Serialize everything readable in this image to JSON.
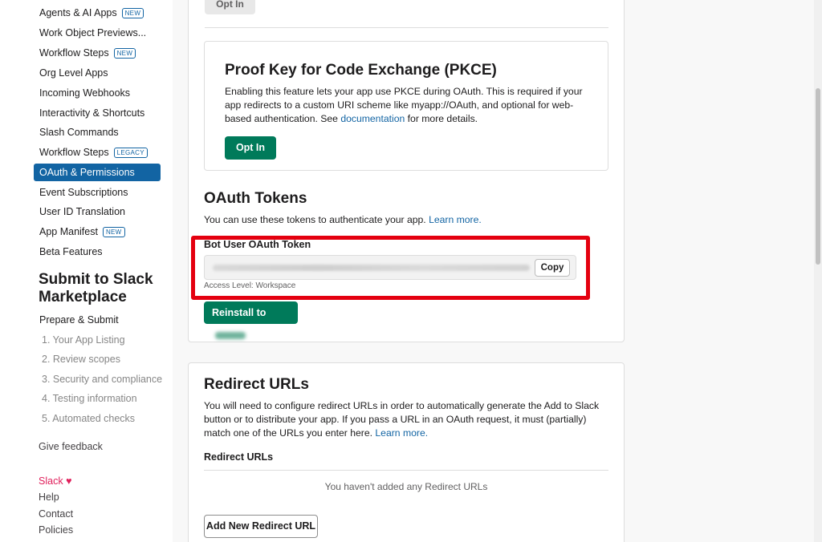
{
  "sidebar": {
    "items": [
      {
        "label": "Agents & AI Apps",
        "badge": "NEW"
      },
      {
        "label": "Work Object Previews...",
        "badge": ""
      },
      {
        "label": "Workflow Steps",
        "badge": "NEW"
      },
      {
        "label": "Org Level Apps",
        "badge": ""
      },
      {
        "label": "Incoming Webhooks",
        "badge": ""
      },
      {
        "label": "Interactivity & Shortcuts",
        "badge": ""
      },
      {
        "label": "Slash Commands",
        "badge": ""
      },
      {
        "label": "Workflow Steps",
        "badge": "LEGACY"
      },
      {
        "label": "OAuth & Permissions",
        "badge": "",
        "active": true
      },
      {
        "label": "Event Subscriptions",
        "badge": ""
      },
      {
        "label": "User ID Translation",
        "badge": ""
      },
      {
        "label": "App Manifest",
        "badge": "NEW"
      },
      {
        "label": "Beta Features",
        "badge": ""
      }
    ],
    "marketplace_heading": "Submit to Slack Marketplace",
    "prepare_submit": "Prepare & Submit",
    "steps": [
      "1. Your App Listing",
      "2. Review scopes",
      "3. Security and compliance",
      "4. Testing information",
      "5. Automated checks"
    ],
    "give_feedback": "Give feedback",
    "footer": {
      "slack": "Slack",
      "heart": "♥",
      "help": "Help",
      "contact": "Contact",
      "policies": "Policies"
    }
  },
  "top_opt_in_label": "Opt In",
  "pkce": {
    "title": "Proof Key for Code Exchange (PKCE)",
    "description_before": "Enabling this feature lets your app use PKCE during OAuth. This is required if your app redirects to a custom URI scheme like myapp://OAuth, and optional for web-based authentication. See ",
    "doc_link": "documentation",
    "description_after": " for more details.",
    "button": "Opt In"
  },
  "oauth_tokens": {
    "title": "OAuth Tokens",
    "description": "You can use these tokens to authenticate your app. ",
    "learn_more": "Learn more.",
    "token_label": "Bot User OAuth Token",
    "copy_button": "Copy",
    "access_level": "Access Level: Workspace",
    "reinstall_button": "Reinstall to"
  },
  "redirect": {
    "title": "Redirect URLs",
    "description": "You will need to configure redirect URLs in order to automatically generate the Add to Slack button or to distribute your app. If you pass a URL in an OAuth request, it must (partially) match one of the URLs you enter here. ",
    "learn_more": "Learn more.",
    "subheading": "Redirect URLs",
    "empty": "You haven't added any Redirect URLs",
    "add_button": "Add New Redirect URL"
  },
  "colors": {
    "accent_blue": "#1264a3",
    "green_button": "#007a5a",
    "highlight_red": "#e4000f",
    "slack_pink": "#e01e5a"
  }
}
